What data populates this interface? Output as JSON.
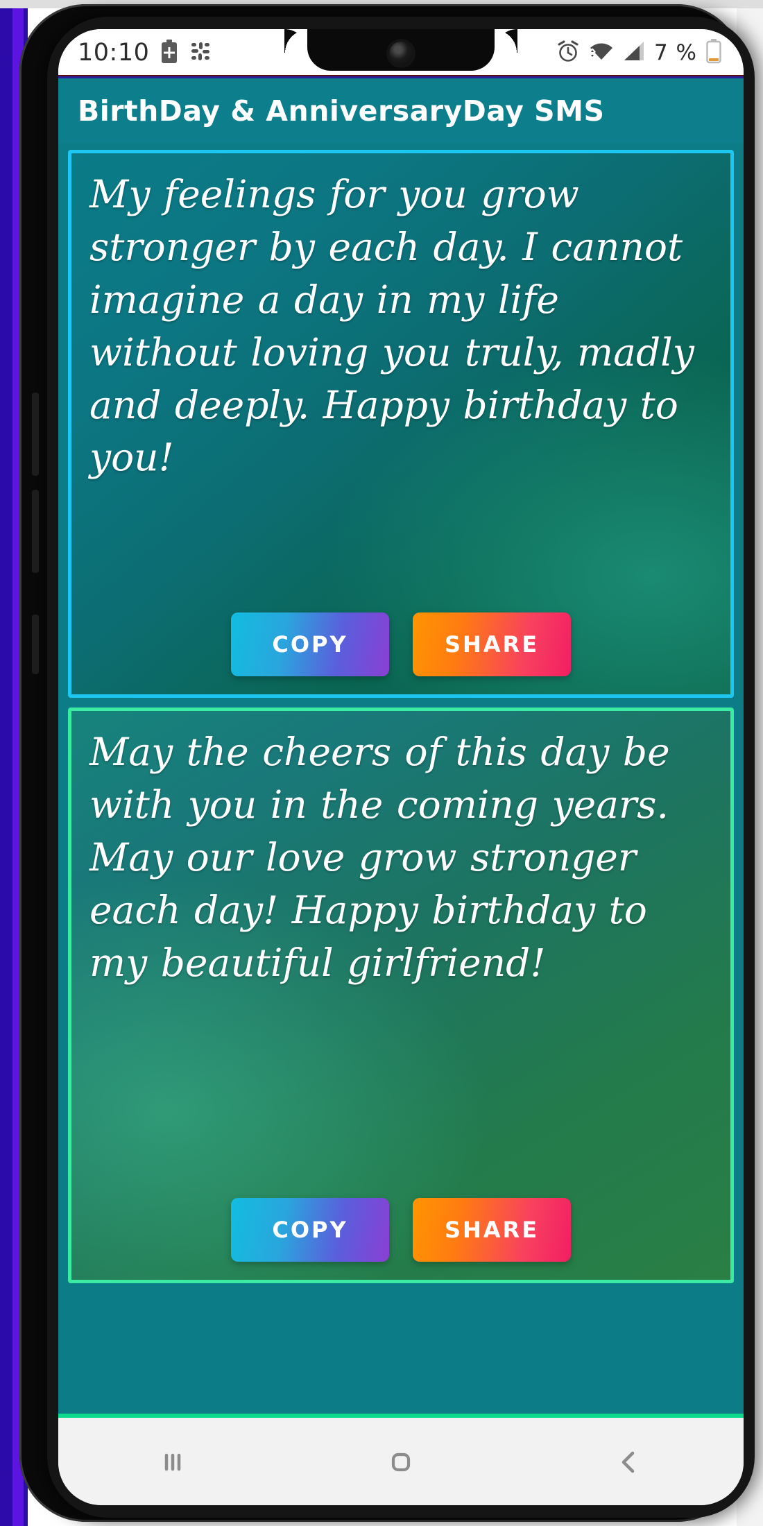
{
  "statusbar": {
    "time": "10:10",
    "battery_percent": "7 %",
    "icons": [
      "battery-saver-icon",
      "slack-icon",
      "alarm-icon",
      "wifi-icon",
      "cellular-signal-icon",
      "battery-icon"
    ]
  },
  "appbar": {
    "title": "BirthDay & AnniversaryDay SMS"
  },
  "colors": {
    "appbar_teal": "#0d7f8c",
    "card1_border": "#1ec6f2",
    "card2_border": "#3ceaa4",
    "copy_gradient_start": "#12bde0",
    "copy_gradient_end": "#8a3fd4",
    "share_gradient_start": "#ff9500",
    "share_gradient_end": "#f21e63",
    "navbar_accent": "#0cd98c"
  },
  "cards": [
    {
      "message": "My feelings for you grow stronger by each day. I cannot imagine a day in my life without loving you truly, madly and deeply. Happy birthday to you!",
      "copy_label": "COPY",
      "share_label": "SHARE"
    },
    {
      "message": "May the cheers of this day be with you in the coming years. May our love grow stronger each day! Happy birthday to my beautiful girlfriend!",
      "copy_label": "COPY",
      "share_label": "SHARE"
    }
  ],
  "navbar": {
    "recents_label": "Recents",
    "home_label": "Home",
    "back_label": "Back"
  }
}
